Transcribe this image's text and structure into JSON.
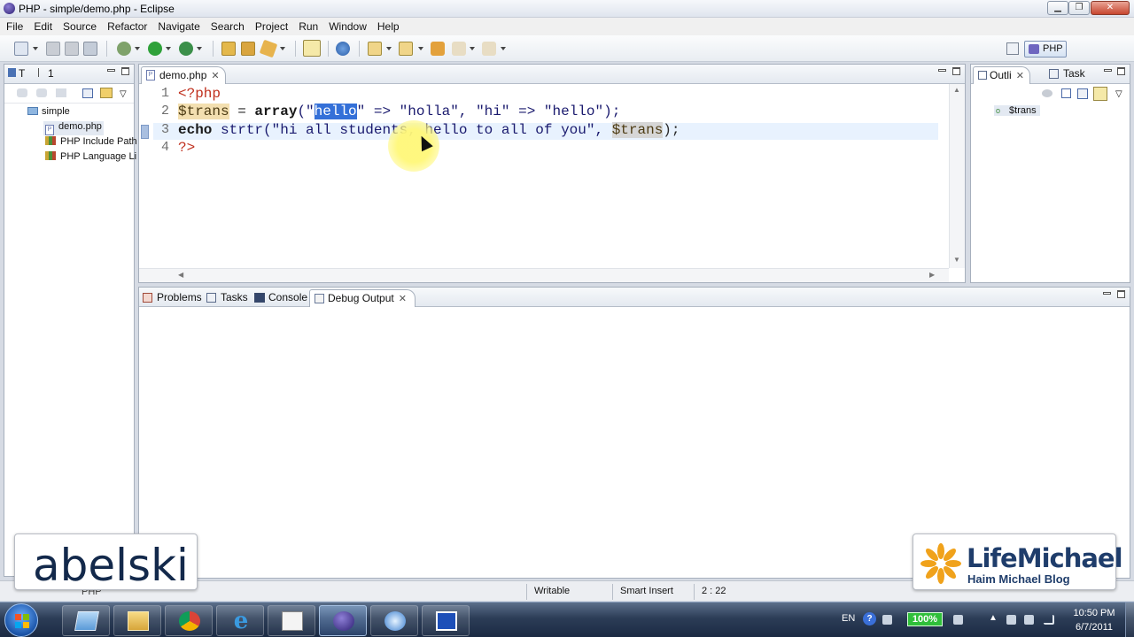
{
  "window": {
    "title": "PHP - simple/demo.php - Eclipse"
  },
  "menu": [
    "File",
    "Edit",
    "Source",
    "Refactor",
    "Navigate",
    "Search",
    "Project",
    "Run",
    "Window",
    "Help"
  ],
  "perspective": {
    "label": "PHP"
  },
  "navigator": {
    "tabs": [
      "T",
      "1"
    ],
    "items": [
      {
        "label": "simple",
        "type": "project"
      },
      {
        "label": "demo.php",
        "type": "file"
      },
      {
        "label": "PHP Include Path",
        "type": "library"
      },
      {
        "label": "PHP Language Li",
        "type": "library"
      }
    ]
  },
  "editor": {
    "tab_label": "demo.php",
    "lines": [
      {
        "num": "1"
      },
      {
        "num": "2"
      },
      {
        "num": "3"
      },
      {
        "num": "4"
      }
    ],
    "line1": {
      "open": "<?php"
    },
    "line2": {
      "var": "$trans",
      "eq": " = ",
      "fn": "array",
      "p1": "(\"",
      "sel": "hello",
      "rest": "\" => \"holla\", \"hi\" => \"hello\");"
    },
    "line3": {
      "kw": "echo",
      "rest": " strtr(\"hi all students, hello to all of you\", ",
      "var": "$trans",
      "end": ");"
    },
    "line4": {
      "close": "?>"
    }
  },
  "outline": {
    "tabs": [
      "Outli",
      "Task"
    ],
    "items": [
      "$trans"
    ]
  },
  "bottom": {
    "tabs": [
      "Problems",
      "Tasks",
      "Console",
      "Debug Output"
    ]
  },
  "status": {
    "writable": "Writable",
    "insert_mode": "Smart Insert",
    "position": "2 : 22",
    "left_hint": "PHP"
  },
  "watermarks": {
    "left": "abelski",
    "right_title": "LifeMichael",
    "right_sub": "Haim Michael Blog"
  },
  "taskbar": {
    "lang": "EN",
    "battery": "100%",
    "time": "10:50 PM",
    "date": "6/7/2011"
  },
  "colors": {
    "selection": "#3470d8",
    "accent": "#2fbf3a"
  }
}
